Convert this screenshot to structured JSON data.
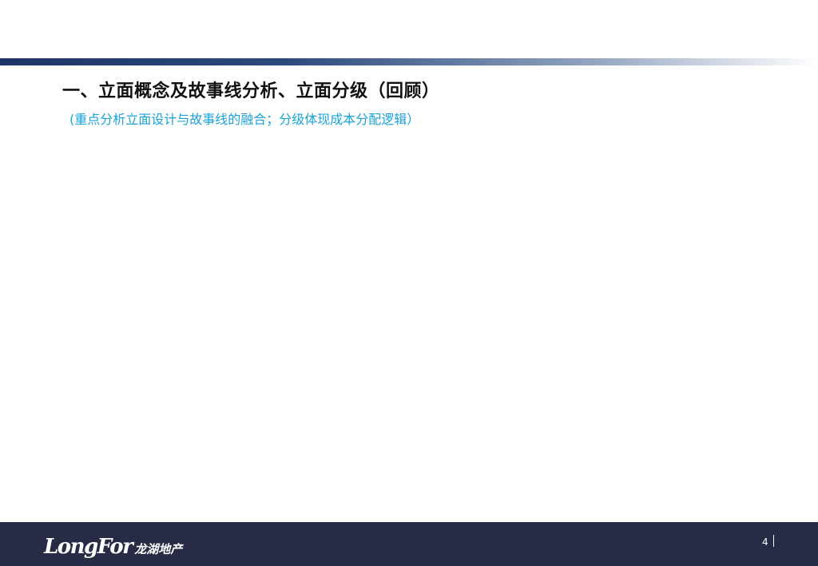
{
  "slide": {
    "title": "一、立面概念及故事线分析、立面分级（回顾）",
    "subtitle": "(重点分析立面设计与故事线的融合；分级体现成本分配逻辑）"
  },
  "footer": {
    "logo_wordmark": "LongFor",
    "logo_cn": "龙湖地产",
    "page_number": "4"
  },
  "colors": {
    "header_bar": "#1c3566",
    "subtitle": "#1aa3d9",
    "footer_bg": "#272b46"
  }
}
